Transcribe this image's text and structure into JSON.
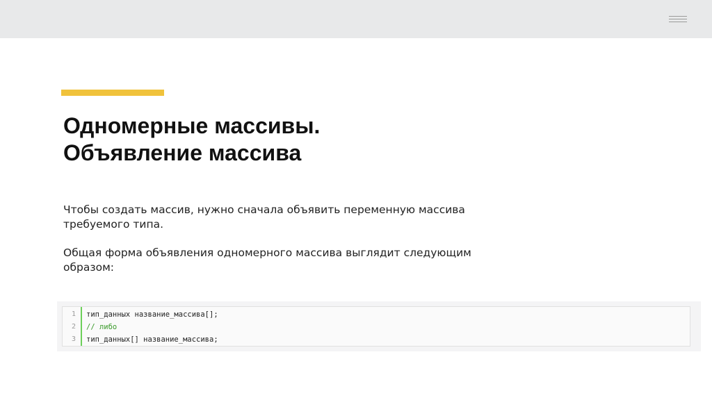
{
  "slide": {
    "title_lines": [
      "Одномерные массивы.",
      "Объявление массива"
    ],
    "paragraph1_lines": [
      "Чтобы создать массив, нужно сначала объявить переменную массива",
      "требуемого типа."
    ],
    "paragraph2_lines": [
      "Общая форма объявления одномерного массива выглядит следующим",
      "образом:"
    ],
    "code": {
      "line_numbers": [
        "1",
        "2",
        "3"
      ],
      "lines": [
        "тип_данных название_массива[];",
        "// либо",
        "тип_данных[] название_массива;"
      ]
    }
  },
  "colors": {
    "accent": "#f0c23b",
    "top_bar": "#e8e9ea",
    "code_comment": "#3a9a2a",
    "gutter_border": "#6ccf5a"
  },
  "icons": {
    "menu": "hamburger-menu-icon"
  }
}
